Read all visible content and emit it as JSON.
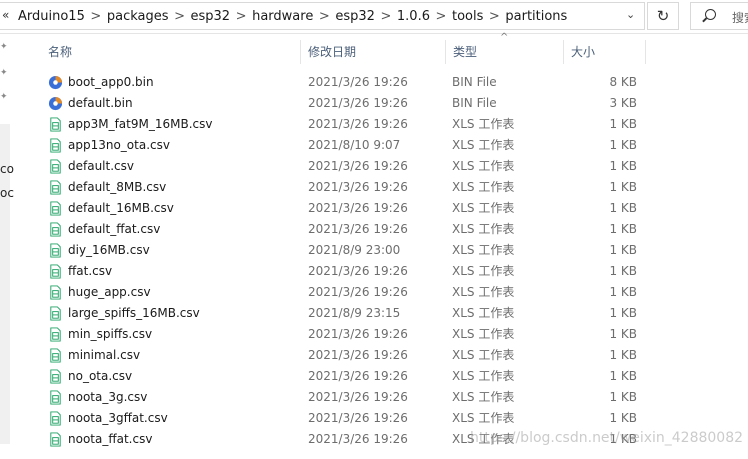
{
  "address_bar": {
    "prefix": "«",
    "crumbs": [
      "Arduino15",
      "packages",
      "esp32",
      "hardware",
      "esp32",
      "1.0.6",
      "tools",
      "partitions"
    ],
    "separator": ">",
    "dropdown_glyph": "⌄"
  },
  "refresh_glyph": "↻",
  "search": {
    "placeholder": "搜索"
  },
  "nav": {
    "cut_labels": [
      "co",
      "oc"
    ]
  },
  "columns": {
    "name": "名称",
    "modified": "修改日期",
    "type": "类型",
    "size": "大小",
    "sort_indicator": "^"
  },
  "files": [
    {
      "name": "boot_app0.bin",
      "modified": "2021/3/26 19:26",
      "type": "BIN File",
      "size": "8 KB",
      "icon": "bin-file-icon"
    },
    {
      "name": "default.bin",
      "modified": "2021/3/26 19:26",
      "type": "BIN File",
      "size": "3 KB",
      "icon": "bin-file-icon"
    },
    {
      "name": "app3M_fat9M_16MB.csv",
      "modified": "2021/3/26 19:26",
      "type": "XLS 工作表",
      "size": "1 KB",
      "icon": "csv-file-icon"
    },
    {
      "name": "app13no_ota.csv",
      "modified": "2021/8/10 9:07",
      "type": "XLS 工作表",
      "size": "1 KB",
      "icon": "csv-file-icon"
    },
    {
      "name": "default.csv",
      "modified": "2021/3/26 19:26",
      "type": "XLS 工作表",
      "size": "1 KB",
      "icon": "csv-file-icon"
    },
    {
      "name": "default_8MB.csv",
      "modified": "2021/3/26 19:26",
      "type": "XLS 工作表",
      "size": "1 KB",
      "icon": "csv-file-icon"
    },
    {
      "name": "default_16MB.csv",
      "modified": "2021/3/26 19:26",
      "type": "XLS 工作表",
      "size": "1 KB",
      "icon": "csv-file-icon"
    },
    {
      "name": "default_ffat.csv",
      "modified": "2021/3/26 19:26",
      "type": "XLS 工作表",
      "size": "1 KB",
      "icon": "csv-file-icon"
    },
    {
      "name": "diy_16MB.csv",
      "modified": "2021/8/9 23:00",
      "type": "XLS 工作表",
      "size": "1 KB",
      "icon": "csv-file-icon"
    },
    {
      "name": "ffat.csv",
      "modified": "2021/3/26 19:26",
      "type": "XLS 工作表",
      "size": "1 KB",
      "icon": "csv-file-icon"
    },
    {
      "name": "huge_app.csv",
      "modified": "2021/3/26 19:26",
      "type": "XLS 工作表",
      "size": "1 KB",
      "icon": "csv-file-icon"
    },
    {
      "name": "large_spiffs_16MB.csv",
      "modified": "2021/8/9 23:15",
      "type": "XLS 工作表",
      "size": "1 KB",
      "icon": "csv-file-icon"
    },
    {
      "name": "min_spiffs.csv",
      "modified": "2021/3/26 19:26",
      "type": "XLS 工作表",
      "size": "1 KB",
      "icon": "csv-file-icon"
    },
    {
      "name": "minimal.csv",
      "modified": "2021/3/26 19:26",
      "type": "XLS 工作表",
      "size": "1 KB",
      "icon": "csv-file-icon"
    },
    {
      "name": "no_ota.csv",
      "modified": "2021/3/26 19:26",
      "type": "XLS 工作表",
      "size": "1 KB",
      "icon": "csv-file-icon"
    },
    {
      "name": "noota_3g.csv",
      "modified": "2021/3/26 19:26",
      "type": "XLS 工作表",
      "size": "1 KB",
      "icon": "csv-file-icon"
    },
    {
      "name": "noota_3gffat.csv",
      "modified": "2021/3/26 19:26",
      "type": "XLS 工作表",
      "size": "1 KB",
      "icon": "csv-file-icon"
    },
    {
      "name": "noota_ffat.csv",
      "modified": "2021/3/26 19:26",
      "type": "XLS 工作表",
      "size": "1 KB",
      "icon": "csv-file-icon"
    }
  ],
  "watermark": "https://blog.csdn.net/weixin_42880082",
  "colors": {
    "header_text": "#4c607a",
    "csv_icon_green": "#21a366",
    "bin_icon_blue": "#3b6fd8",
    "bin_icon_orange": "#e08a2c"
  }
}
